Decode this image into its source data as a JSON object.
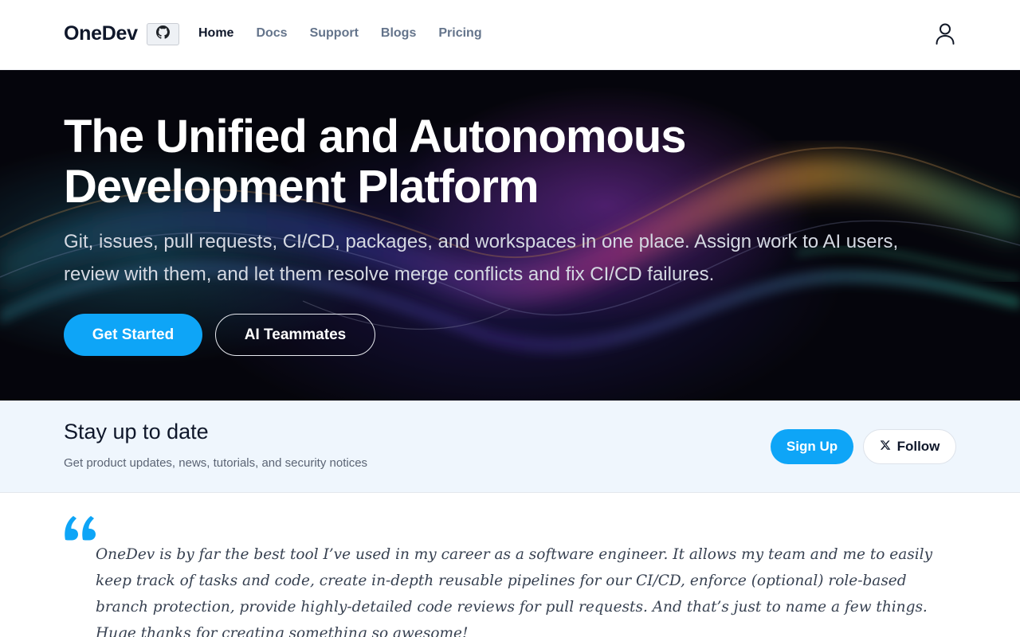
{
  "header": {
    "logo": "OneDev",
    "github_icon": "github-icon",
    "nav": [
      {
        "label": "Home",
        "active": true
      },
      {
        "label": "Docs",
        "active": false
      },
      {
        "label": "Support",
        "active": false
      },
      {
        "label": "Blogs",
        "active": false
      },
      {
        "label": "Pricing",
        "active": false
      }
    ],
    "user_icon": "user-icon"
  },
  "hero": {
    "title_line1": "The Unified and Autonomous",
    "title_line2": "Development Platform",
    "subtitle": "Git, issues, pull requests, CI/CD, packages, and workspaces in one place. Assign work to AI users, review with them, and let them resolve merge conflicts and fix CI/CD failures.",
    "primary_cta": "Get Started",
    "secondary_cta": "AI Teammates"
  },
  "newsletter": {
    "title": "Stay up to date",
    "subtitle": "Get product updates, news, tutorials, and security notices",
    "signup_label": "Sign Up",
    "follow_label": "Follow",
    "follow_icon": "x-logo-icon"
  },
  "testimonial": {
    "quote_icon": "quote-icon",
    "text": "OneDev is by far the best tool I’ve used in my career as a software engineer. It allows my team and me to easily keep track of tasks and code, create in-depth reusable pipelines for our CI/CD, enforce (optional) role-based branch protection, provide highly-detailed code reviews for pull requests. And that’s just to name a few things. Huge thanks for creating something so awesome!"
  },
  "colors": {
    "accent": "#0ea5f7",
    "hero_bg": "#07070f",
    "newsletter_bg": "#eff6fd"
  }
}
